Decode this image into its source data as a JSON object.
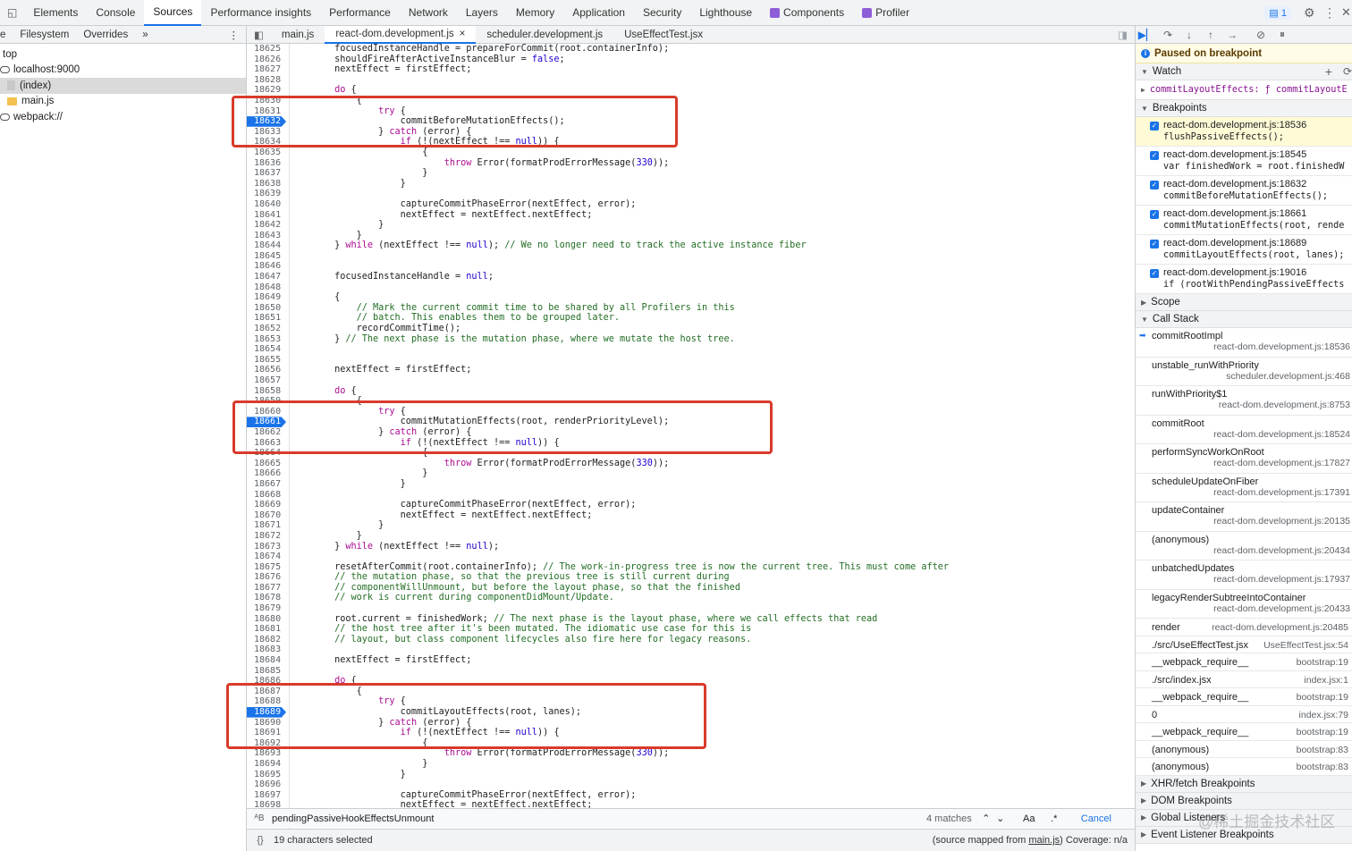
{
  "topbar": {
    "tabs": [
      "Elements",
      "Console",
      "Sources",
      "Performance insights",
      "Performance",
      "Network",
      "Layers",
      "Memory",
      "Application",
      "Security",
      "Lighthouse",
      "Components",
      "Profiler"
    ],
    "active": "Sources",
    "badge": "1"
  },
  "navigator": {
    "tabs": [
      "Filesystem",
      "Overrides"
    ],
    "tree": [
      {
        "label": "top",
        "kind": "text"
      },
      {
        "label": "localhost:9000",
        "kind": "cloud"
      },
      {
        "label": "(index)",
        "kind": "file",
        "selected": true
      },
      {
        "label": "main.js",
        "kind": "folder"
      },
      {
        "label": "webpack://",
        "kind": "cloud"
      }
    ]
  },
  "editor": {
    "tabs": [
      {
        "label": "main.js"
      },
      {
        "label": "react-dom.development.js",
        "active": true,
        "close": "×"
      },
      {
        "label": "scheduler.development.js"
      },
      {
        "label": "UseEffectTest.jsx"
      }
    ],
    "first_line": 18625,
    "breakpoints": [
      18632,
      18661,
      18689
    ],
    "lines": [
      "        focusedInstanceHandle = prepareForCommit(root.containerInfo);",
      "        shouldFireAfterActiveInstanceBlur = false;",
      "        nextEffect = firstEffect;",
      "",
      "        do {",
      "            {",
      "                try {",
      "                    commitBeforeMutationEffects();",
      "                } catch (error) {",
      "                    if (!(nextEffect !== null)) {",
      "                        {",
      "                            throw Error(formatProdErrorMessage(330));",
      "                        }",
      "                    }",
      "",
      "                    captureCommitPhaseError(nextEffect, error);",
      "                    nextEffect = nextEffect.nextEffect;",
      "                }",
      "            }",
      "        } while (nextEffect !== null); // We no longer need to track the active instance fiber",
      "",
      "",
      "        focusedInstanceHandle = null;",
      "",
      "        {",
      "            // Mark the current commit time to be shared by all Profilers in this",
      "            // batch. This enables them to be grouped later.",
      "            recordCommitTime();",
      "        } // The next phase is the mutation phase, where we mutate the host tree.",
      "",
      "",
      "        nextEffect = firstEffect;",
      "",
      "        do {",
      "            {",
      "                try {",
      "                    commitMutationEffects(root, renderPriorityLevel);",
      "                } catch (error) {",
      "                    if (!(nextEffect !== null)) {",
      "                        {",
      "                            throw Error(formatProdErrorMessage(330));",
      "                        }",
      "                    }",
      "",
      "                    captureCommitPhaseError(nextEffect, error);",
      "                    nextEffect = nextEffect.nextEffect;",
      "                }",
      "            }",
      "        } while (nextEffect !== null);",
      "",
      "        resetAfterCommit(root.containerInfo); // The work-in-progress tree is now the current tree. This must come after",
      "        // the mutation phase, so that the previous tree is still current during",
      "        // componentWillUnmount, but before the layout phase, so that the finished",
      "        // work is current during componentDidMount/Update.",
      "",
      "        root.current = finishedWork; // The next phase is the layout phase, where we call effects that read",
      "        // the host tree after it's been mutated. The idiomatic use case for this is",
      "        // layout, but class component lifecycles also fire here for legacy reasons.",
      "",
      "        nextEffect = firstEffect;",
      "",
      "        do {",
      "            {",
      "                try {",
      "                    commitLayoutEffects(root, lanes);",
      "                } catch (error) {",
      "                    if (!(nextEffect !== null)) {",
      "                        {",
      "                            throw Error(formatProdErrorMessage(330));",
      "                        }",
      "                    }",
      "",
      "                    captureCommitPhaseError(nextEffect, error);",
      "                    nextEffect = nextEffect.nextEffect;"
    ],
    "search": {
      "query": "pendingPassiveHookEffectsUnmount",
      "matches": "4 matches",
      "case": "Aa",
      "regex": ".*",
      "cancel": "Cancel"
    },
    "status": {
      "selection": "19 characters selected",
      "mapped_prefix": "(source mapped from ",
      "mapped_link": "main.js",
      "mapped_suffix": ") Coverage: n/a"
    }
  },
  "debugger": {
    "paused": "Paused on breakpoint",
    "watch": {
      "title": "Watch",
      "expr": "commitLayoutEffects: ƒ commitLayoutE"
    },
    "breakpoints": {
      "title": "Breakpoints",
      "items": [
        {
          "loc": "react-dom.development.js:18536",
          "code": "flushPassiveEffects();",
          "current": true
        },
        {
          "loc": "react-dom.development.js:18545",
          "code": "var finishedWork = root.finishedW"
        },
        {
          "loc": "react-dom.development.js:18632",
          "code": "commitBeforeMutationEffects();"
        },
        {
          "loc": "react-dom.development.js:18661",
          "code": "commitMutationEffects(root, rende"
        },
        {
          "loc": "react-dom.development.js:18689",
          "code": "commitLayoutEffects(root, lanes);"
        },
        {
          "loc": "react-dom.development.js:19016",
          "code": "if (rootWithPendingPassiveEffects"
        }
      ]
    },
    "scope": "Scope",
    "callstack": {
      "title": "Call Stack",
      "frames": [
        {
          "name": "commitRootImpl",
          "loc": "react-dom.development.js:18536",
          "two": true,
          "current": true
        },
        {
          "name": "unstable_runWithPriority",
          "loc": "scheduler.development.js:468",
          "two": true
        },
        {
          "name": "runWithPriority$1",
          "loc": "react-dom.development.js:8753",
          "two": true
        },
        {
          "name": "commitRoot",
          "loc": "react-dom.development.js:18524",
          "two": true
        },
        {
          "name": "performSyncWorkOnRoot",
          "loc": "react-dom.development.js:17827",
          "two": true
        },
        {
          "name": "scheduleUpdateOnFiber",
          "loc": "react-dom.development.js:17391",
          "two": true
        },
        {
          "name": "updateContainer",
          "loc": "react-dom.development.js:20135",
          "two": true
        },
        {
          "name": "(anonymous)",
          "loc": "react-dom.development.js:20434",
          "two": true
        },
        {
          "name": "unbatchedUpdates",
          "loc": "react-dom.development.js:17937",
          "two": true
        },
        {
          "name": "legacyRenderSubtreeIntoContainer",
          "loc": "react-dom.development.js:20433",
          "two": true
        },
        {
          "name": "render",
          "loc": "react-dom.development.js:20485"
        },
        {
          "name": "./src/UseEffectTest.jsx",
          "loc": "UseEffectTest.jsx:54"
        },
        {
          "name": "__webpack_require__",
          "loc": "bootstrap:19"
        },
        {
          "name": "./src/index.jsx",
          "loc": "index.jsx:1"
        },
        {
          "name": "__webpack_require__",
          "loc": "bootstrap:19"
        },
        {
          "name": "0",
          "loc": "index.jsx:79"
        },
        {
          "name": "__webpack_require__",
          "loc": "bootstrap:19"
        },
        {
          "name": "(anonymous)",
          "loc": "bootstrap:83"
        },
        {
          "name": "(anonymous)",
          "loc": "bootstrap:83"
        }
      ]
    },
    "more_sections": [
      "XHR/fetch Breakpoints",
      "DOM Breakpoints",
      "Global Listeners",
      "Event Listener Breakpoints"
    ]
  },
  "watermark": "@稀土掘金技术社区"
}
